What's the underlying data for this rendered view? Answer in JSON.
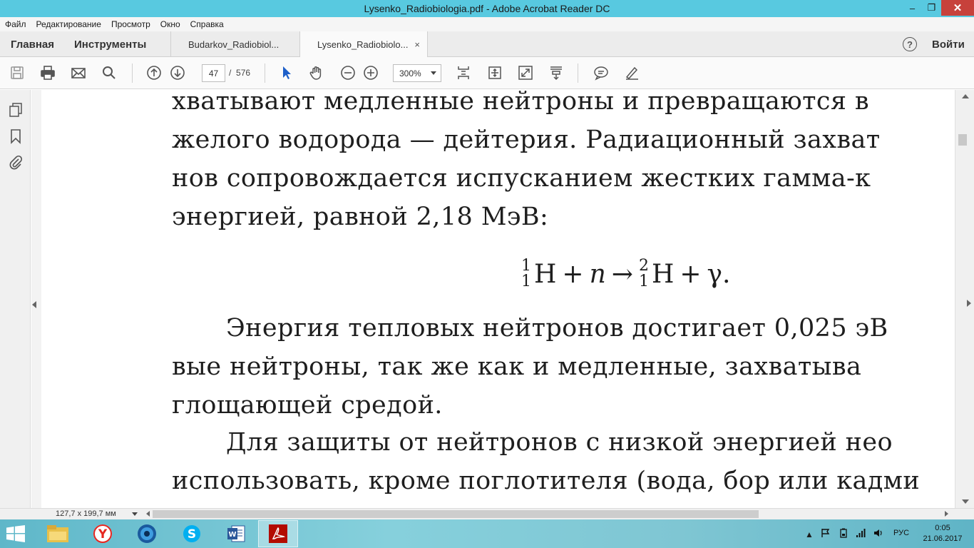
{
  "window": {
    "title": "Lysenko_Radiobiologia.pdf - Adobe Acrobat Reader DC",
    "minimize": "–",
    "maximize": "❐",
    "close": "✕"
  },
  "menu": [
    "Файл",
    "Редактирование",
    "Просмотр",
    "Окно",
    "Справка"
  ],
  "tabs": {
    "home": "Главная",
    "tools": "Инструменты",
    "documents": [
      {
        "label": "Budarkov_Radiobiol...",
        "active": false
      },
      {
        "label": "Lysenko_Radiobiolo...",
        "active": true
      }
    ],
    "close_glyph": "×",
    "help": "?",
    "sign_in": "Войти"
  },
  "toolbar": {
    "current_page": "47",
    "separator": "/",
    "total_pages": "576",
    "zoom": "300%"
  },
  "document": {
    "lines": [
      "хватывают медленные нейтроны и превращаются в",
      "желого водорода — дейтерия. Радиационный захват",
      "нов сопровождается испусканием жестких гамма-к",
      "энергией, равной 2,18 МэВ:"
    ],
    "formula": {
      "reactant_mass": "1",
      "reactant_charge": "1",
      "reactant_symbol": "H",
      "plus1": "+",
      "neutron": "n",
      "arrow": "→",
      "product_mass": "2",
      "product_charge": "1",
      "product_symbol": "H",
      "plus2": "+",
      "gamma": "γ."
    },
    "lines2": [
      "Энергия тепловых нейтронов достигает 0,025 эВ",
      "вые нейтроны, так же как и медленные, захватыва",
      "глощающей средой.",
      "Для защиты от нейтронов с низкой энергией нео",
      "использовать, кроме поглотителя (вода, бор или кадми"
    ]
  },
  "status": {
    "page_size": "127,7 x 199,7 мм"
  },
  "taskbar": {
    "language": "РУС",
    "time": "0:05",
    "date": "21.06.2017"
  },
  "colors": {
    "titlebar": "#58c9e0",
    "close_button": "#c7413b",
    "select_tool": "#1d5fc9"
  }
}
